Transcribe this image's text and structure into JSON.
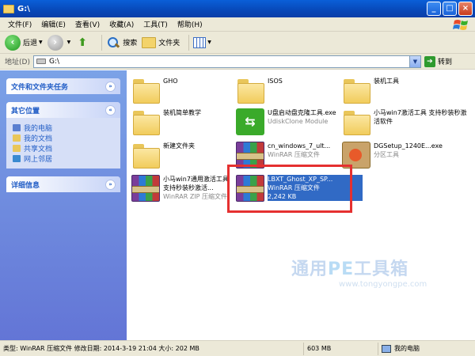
{
  "window": {
    "title": "G:\\",
    "buttons": {
      "minimize": "_",
      "maximize": "□",
      "close": "×"
    }
  },
  "menu": [
    "文件(F)",
    "编辑(E)",
    "查看(V)",
    "收藏(A)",
    "工具(T)",
    "帮助(H)"
  ],
  "toolbar": {
    "back": "后退",
    "search": "搜索",
    "folders": "文件夹"
  },
  "address": {
    "label": "地址(D)",
    "value": "G:\\",
    "go": "转到"
  },
  "left_pane": {
    "tasks_title": "文件和文件夹任务",
    "other_title": "其它位置",
    "places": [
      {
        "label": "我的电脑",
        "color": "#5a7fd0"
      },
      {
        "label": "我的文档",
        "color": "#e9c65a"
      },
      {
        "label": "共享文档",
        "color": "#e9c65a"
      },
      {
        "label": "网上邻居",
        "color": "#3a8ad0"
      }
    ],
    "details_title": "详细信息"
  },
  "files": [
    {
      "name": "GHO",
      "type": "folder",
      "col": 0,
      "row": 0
    },
    {
      "name": "ISOS",
      "type": "folder",
      "col": 1,
      "row": 0
    },
    {
      "name": "装机工具",
      "type": "folder",
      "col": 2,
      "row": 0
    },
    {
      "name": "装机简单教学",
      "type": "folder",
      "col": 0,
      "row": 1
    },
    {
      "name": "U盘启动盘克隆工具.exe",
      "sub": "UdiskClone Module",
      "type": "usb",
      "col": 1,
      "row": 1
    },
    {
      "name": "小马win7激活工具 支持秒装秒激活软件",
      "type": "folder",
      "col": 2,
      "row": 1
    },
    {
      "name": "新建文件夹",
      "type": "folder",
      "col": 0,
      "row": 2
    },
    {
      "name": "cn_windows_7_ult...",
      "sub": "WinRAR 压缩文件",
      "type": "rar",
      "col": 1,
      "row": 2
    },
    {
      "name": "DGSetup_1240E...exe",
      "sub": "分区工具",
      "type": "setup",
      "col": 2,
      "row": 2
    },
    {
      "name": "小马win7通用激活工具 支持秒装秒激活...",
      "sub": "WinRAR ZIP 压缩文件",
      "type": "rar",
      "col": 0,
      "row": 3
    },
    {
      "name": "LBXT_Ghost_XP_SP...",
      "sub": "WinRAR 压缩文件",
      "sub2": "2,242 KB",
      "type": "rar",
      "col": 1,
      "row": 3,
      "selected": true
    }
  ],
  "watermark": {
    "main_a": "通用",
    "main_pe": "PE",
    "main_b": "工具箱",
    "url": "www.tongyongpe.com"
  },
  "status": {
    "info": "类型: WinRAR 压缩文件 修改日期: 2014-3-19 21:04 大小: 202 MB",
    "size": "603 MB",
    "location": "我的电脑"
  }
}
